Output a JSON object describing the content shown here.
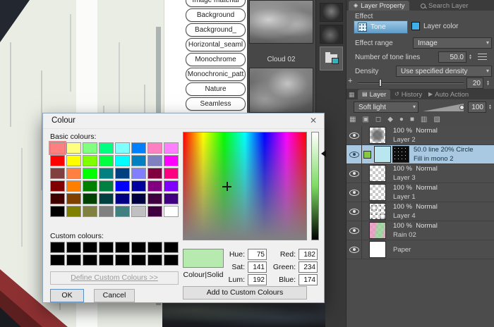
{
  "icons": {
    "dropdown_arrow": "▾",
    "spin_up": "▴",
    "spin_down": "▾",
    "close": "✕",
    "plus": "+",
    "layer_property_tab_icon": "◈",
    "layer_tab_icon": "▤",
    "history_tab_icon": "↺",
    "auto_action_tab_icon": "▶",
    "layer_panel_grid_icon": "▦"
  },
  "material_list": {
    "items": [
      "Image material",
      "Background",
      "Background_",
      "Horizontal_seaml",
      "Monochrome",
      "Monochronic_patt",
      "Nature",
      "Seamless"
    ]
  },
  "material_panel": {
    "cloud_label": "Cloud 02"
  },
  "layer_property": {
    "tab_layer_property": "Layer Property",
    "tab_search_layer": "Search Layer",
    "effect_label": "Effect",
    "tone_button": "Tone",
    "layer_color_button": "Layer color",
    "effect_range_label": "Effect range",
    "effect_range_value": "Image",
    "tone_lines_label": "Number of tone lines",
    "tone_lines_value": "50.0",
    "density_label": "Density",
    "density_value": "Use specified density",
    "density_slider_value": "20"
  },
  "layer_panel": {
    "tab_layer": "Layer",
    "tab_history": "History",
    "tab_auto_action": "Auto Action",
    "blend_mode": "Soft light",
    "opacity_value": "100",
    "toolbar_icons": [
      {
        "name": "transparency-lock-icon",
        "glyph": "▦"
      },
      {
        "name": "pixel-lock-icon",
        "glyph": "▣"
      },
      {
        "name": "mask-icon",
        "glyph": "◻"
      },
      {
        "name": "ruler-icon",
        "glyph": "◆"
      },
      {
        "name": "set-color-icon",
        "glyph": "●"
      },
      {
        "name": "clip-icon",
        "glyph": "■"
      },
      {
        "name": "reference-icon",
        "glyph": "▥"
      },
      {
        "name": "two-pane-icon",
        "glyph": "▧"
      }
    ],
    "layers": [
      {
        "info": "100 %  Normal",
        "name": "Layer 2",
        "thumbs": [
          "checker-gray"
        ],
        "selected": false
      },
      {
        "info": "50.0 line 20% Circle",
        "name": "Fill in mono 2",
        "thumbs": [
          "cyan",
          "dots"
        ],
        "selected": true
      },
      {
        "info": "100 %  Normal",
        "name": "Layer 3",
        "thumbs": [
          "checker-light"
        ],
        "selected": false
      },
      {
        "info": "100 %  Normal",
        "name": "Layer 1",
        "thumbs": [
          "checker-light"
        ],
        "selected": false
      },
      {
        "info": "100 %  Normal",
        "name": "Layer 4",
        "thumbs": [
          "checker-dots"
        ],
        "selected": false
      },
      {
        "info": "100 %  Normal",
        "name": "Rain 02",
        "thumbs": [
          "checker-rain"
        ],
        "selected": false
      },
      {
        "info": "",
        "name": "Paper",
        "thumbs": [
          "white"
        ],
        "selected": false
      }
    ]
  },
  "colour_dialog": {
    "title": "Colour",
    "basic_label": "Basic colours:",
    "custom_label": "Custom colours:",
    "define_button": "Define Custom Colours >>",
    "ok": "OK",
    "cancel": "Cancel",
    "add_button": "Add to Custom Colours",
    "colour_solid_label": "Colour|Solid",
    "preview_color": "#b6eaae",
    "selected_basic_index": 0,
    "basic_colours": [
      "#ff8080",
      "#ffff80",
      "#80ff80",
      "#00ff80",
      "#80ffff",
      "#0080ff",
      "#ff80c0",
      "#ff80ff",
      "#ff0000",
      "#ffff00",
      "#80ff00",
      "#00ff40",
      "#00ffff",
      "#0080c0",
      "#8080c0",
      "#ff00ff",
      "#804040",
      "#ff8040",
      "#00ff00",
      "#008080",
      "#004080",
      "#8080ff",
      "#800040",
      "#ff0080",
      "#800000",
      "#ff8000",
      "#008000",
      "#008040",
      "#0000ff",
      "#0000a0",
      "#800080",
      "#8000ff",
      "#400000",
      "#804000",
      "#004000",
      "#004040",
      "#000080",
      "#000040",
      "#400040",
      "#400080",
      "#000000",
      "#808000",
      "#808040",
      "#808080",
      "#408080",
      "#c0c0c0",
      "#400040",
      "#ffffff"
    ],
    "custom_colours": [
      "#000000",
      "#000000",
      "#000000",
      "#000000",
      "#000000",
      "#000000",
      "#000000",
      "#000000",
      "#000000",
      "#000000",
      "#000000",
      "#000000",
      "#000000",
      "#000000",
      "#000000",
      "#000000"
    ],
    "fields": {
      "hue": {
        "label": "Hue:",
        "value": "75"
      },
      "sat": {
        "label": "Sat:",
        "value": "141"
      },
      "lum": {
        "label": "Lum:",
        "value": "192"
      },
      "red": {
        "label": "Red:",
        "value": "182"
      },
      "green": {
        "label": "Green:",
        "value": "234"
      },
      "blue": {
        "label": "Blue:",
        "value": "174"
      }
    }
  }
}
